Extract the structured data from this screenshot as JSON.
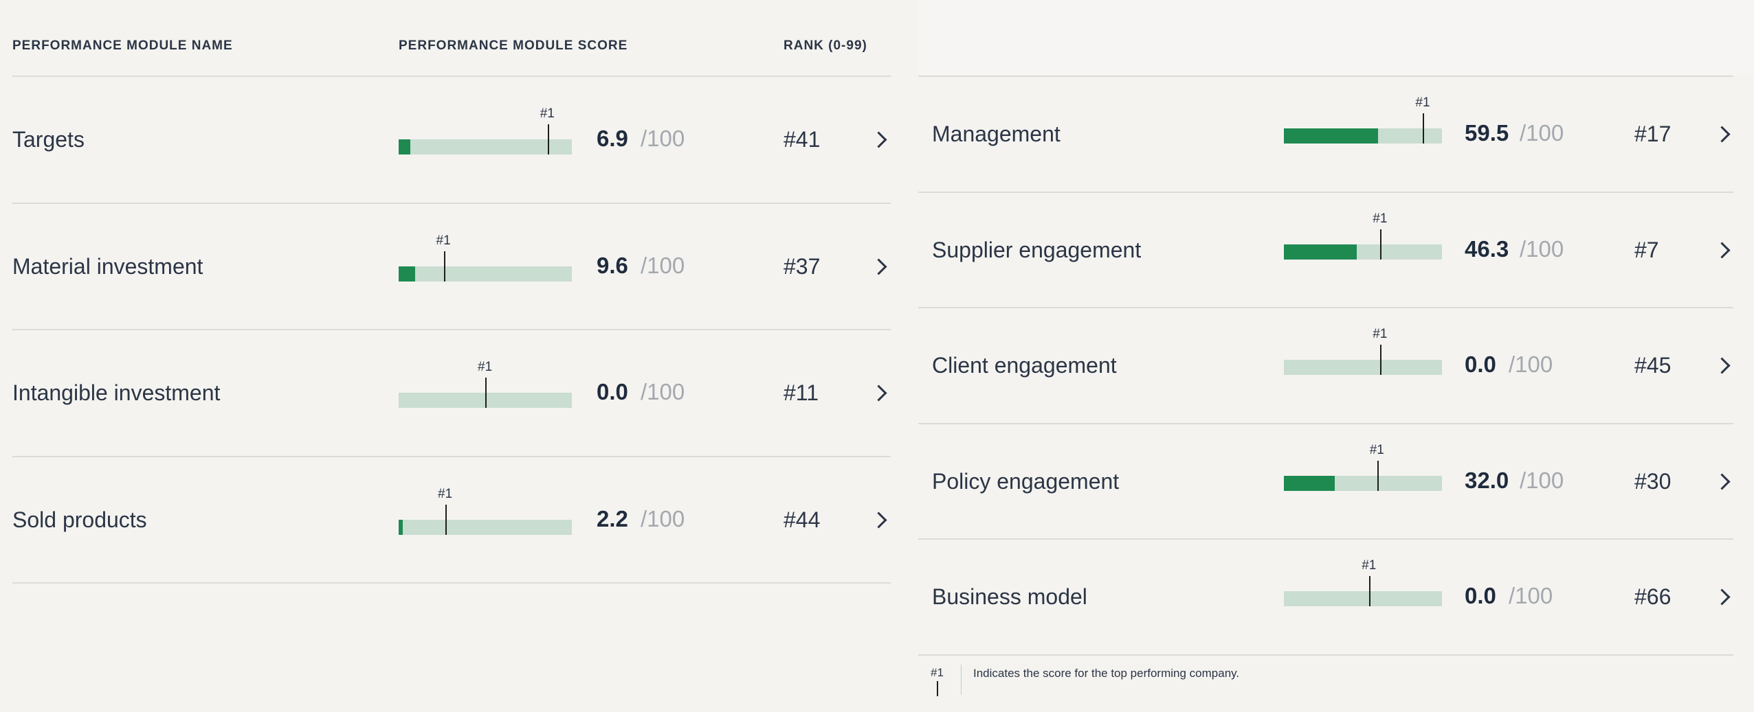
{
  "headers": {
    "name": "PERFORMANCE MODULE NAME",
    "score": "PERFORMANCE MODULE SCORE",
    "rank": "RANK (0-99)"
  },
  "top_marker_label": "#1",
  "score_suffix": "/100",
  "left_rows": [
    {
      "name": "Targets",
      "score": "6.9",
      "score_value": 6.9,
      "top_score_value": 86,
      "rank": "#41"
    },
    {
      "name": "Material investment",
      "score": "9.6",
      "score_value": 9.6,
      "top_score_value": 26,
      "rank": "#37"
    },
    {
      "name": "Intangible investment",
      "score": "0.0",
      "score_value": 0,
      "top_score_value": 50,
      "rank": "#11"
    },
    {
      "name": "Sold products",
      "score": "2.2",
      "score_value": 2.2,
      "top_score_value": 27,
      "rank": "#44"
    }
  ],
  "right_rows": [
    {
      "name": "Management",
      "score": "59.5",
      "score_value": 59.5,
      "top_score_value": 88,
      "rank": "#17"
    },
    {
      "name": "Supplier engagement",
      "score": "46.3",
      "score_value": 46.3,
      "top_score_value": 61,
      "rank": "#7"
    },
    {
      "name": "Client engagement",
      "score": "0.0",
      "score_value": 0,
      "top_score_value": 61,
      "rank": "#45"
    },
    {
      "name": "Policy engagement",
      "score": "32.0",
      "score_value": 32,
      "top_score_value": 59,
      "rank": "#30"
    },
    {
      "name": "Business model",
      "score": "0.0",
      "score_value": 0,
      "top_score_value": 54,
      "rank": "#66"
    }
  ],
  "legend": {
    "mark_label": "#1",
    "text": "Indicates the score for the top performing company."
  },
  "colors": {
    "bar_fill": "#1e8a50",
    "bar_track": "#c9ddd0",
    "marker": "#1e1e1e",
    "text": "#2b3545",
    "muted": "#a3a8ae"
  }
}
